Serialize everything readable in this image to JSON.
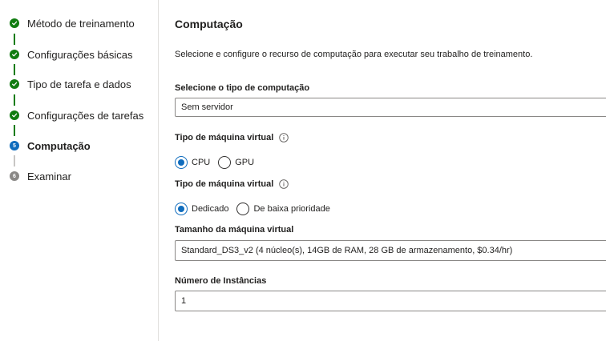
{
  "steps": [
    {
      "label": "Método de treinamento",
      "state": "done"
    },
    {
      "label": "Configurações básicas",
      "state": "done"
    },
    {
      "label": "Tipo de tarefa e dados",
      "state": "done"
    },
    {
      "label": "Configurações de tarefas",
      "state": "done"
    },
    {
      "label": "Computação",
      "state": "current",
      "number": "5"
    },
    {
      "label": "Examinar",
      "state": "pending",
      "number": "6"
    }
  ],
  "section": {
    "title": "Computação",
    "description": "Selecione e configure o recurso de computação para executar seu trabalho de treinamento."
  },
  "compute_type": {
    "label": "Selecione o tipo de computação",
    "value": "Sem servidor"
  },
  "vm_type": {
    "label": "Tipo de máquina virtual",
    "options": [
      "CPU",
      "GPU"
    ],
    "selected": "CPU"
  },
  "vm_tier": {
    "label": "Tipo de máquina virtual",
    "options": [
      "Dedicado",
      "De baixa prioridade"
    ],
    "selected": "Dedicado"
  },
  "vm_size": {
    "label": "Tamanho da máquina virtual",
    "value": "Standard_DS3_v2 (4 núcleo(s), 14GB de RAM, 28 GB de armazenamento, $0.34/hr)"
  },
  "instances": {
    "label": "Número de Instâncias",
    "value": "1"
  },
  "colors": {
    "done": "#107c10",
    "current": "#0f6cbd",
    "pending": "#8a8886",
    "border": "#8a8886"
  }
}
